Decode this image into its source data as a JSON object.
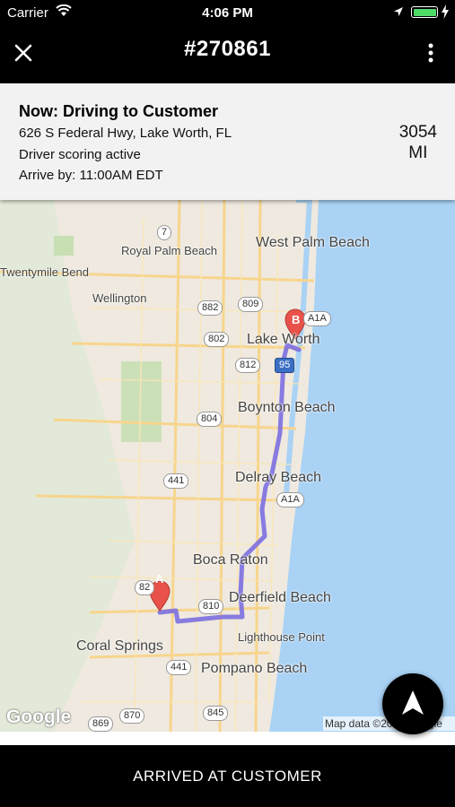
{
  "status_bar": {
    "carrier": "Carrier",
    "time": "4:06 PM"
  },
  "nav": {
    "title": "#270861"
  },
  "job": {
    "status": "Now: Driving to Customer",
    "address": "626 S Federal Hwy, Lake Worth, FL",
    "scoring": "Driver scoring active",
    "arrive_by": "Arrive by: 11:00AM EDT",
    "distance_value": "3054",
    "distance_unit": "MI"
  },
  "map": {
    "places": [
      "West Palm Beach",
      "Royal Palm Beach",
      "Twentymile Bend",
      "Wellington",
      "Lake Worth",
      "Boynton Beach",
      "Delray Beach",
      "Boca Raton",
      "Deerfield Beach",
      "Lighthouse Point",
      "Coral Springs",
      "Pompano Beach"
    ],
    "roads": [
      "7",
      "882",
      "809",
      "802",
      "812",
      "804",
      "441",
      "A1A",
      "810",
      "441",
      "869",
      "870",
      "845",
      "82",
      "A1A",
      "95"
    ],
    "marker_a": "A",
    "marker_b": "B",
    "logo": "Google",
    "attribution": "Map data ©2017 Google"
  },
  "action_button": {
    "label": "ARRIVED AT CUSTOMER"
  },
  "colors": {
    "route": "#7b6fe0",
    "marker": "#e8524a",
    "water": "#a9d2f5",
    "land": "#efe9df"
  }
}
